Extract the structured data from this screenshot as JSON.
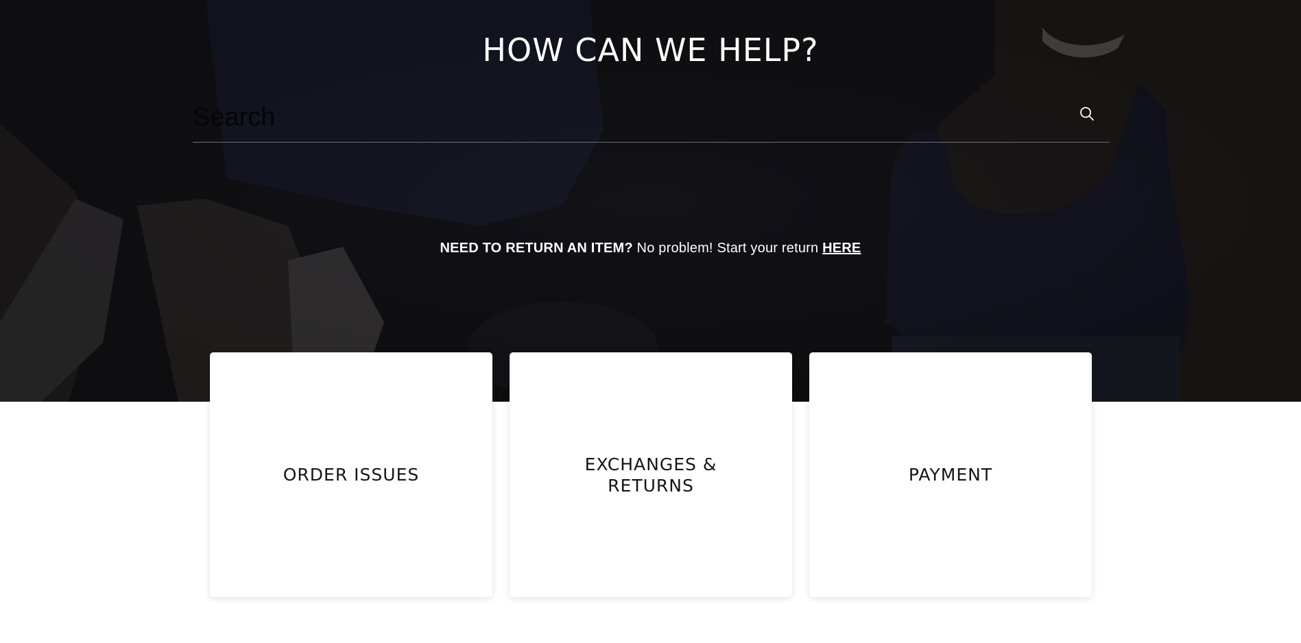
{
  "hero": {
    "title": "HOW CAN WE HELP?"
  },
  "search": {
    "placeholder": "Search",
    "icon": "search-icon"
  },
  "return_banner": {
    "lead": "NEED TO RETURN AN ITEM?",
    "text": "No problem! Start your return",
    "link_label": "HERE"
  },
  "categories": [
    {
      "label": "ORDER ISSUES"
    },
    {
      "label": "EXCHANGES & RETURNS"
    },
    {
      "label": "PAYMENT"
    }
  ],
  "colors": {
    "hero_overlay": "#17161a",
    "text_light": "#ffffff",
    "card_text": "#141414",
    "search_underline": "#6f6f74"
  }
}
